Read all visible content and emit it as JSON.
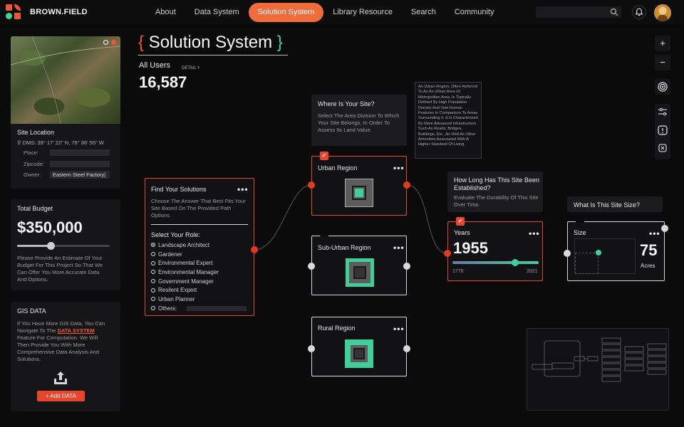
{
  "brand": "BROWN.FIELD",
  "nav": [
    "About",
    "Data System",
    "Solution System",
    "Library Resource",
    "Search",
    "Community"
  ],
  "nav_active": 2,
  "page": {
    "bracket_open": "{",
    "bracket_close": "}",
    "title": "Solution System",
    "all_users_label": "All Users",
    "detail_label": "DETAIL",
    "users_count": "16,587"
  },
  "site": {
    "heading": "Site Location",
    "dms": "DMS: 39° 17' 22\" N, 76° 36' 55\" W",
    "place_label": "Place:",
    "zipcode_label": "Zipcode:",
    "owner_label": "Owner:",
    "owner_value": "Eastern Steel Factory|"
  },
  "budget": {
    "heading": "Total Budget",
    "value": "$350,000",
    "slider_fraction": 0.36,
    "desc": "Please Provide An Estimate Of Your Budget For This Project So That We Can Offer You More Accurate Data And Options."
  },
  "gis": {
    "heading": "GIS DATA",
    "desc_1": "If You Have More GIS Data, You Can Navigate To The",
    "link": "DATA SYSTEM",
    "desc_2": "Feature For Computation. We Will Then Provide You With More Comprehensive Data Analysis And Solutions.",
    "add_button": "+ Add DATA"
  },
  "find": {
    "title": "Find Your Solutions",
    "desc": "Choose The Answer That Best Fits Your Site Based On The Provided Path Options.",
    "role_title": "Select Your Role:",
    "roles": [
      "Landscape Architect",
      "Gardener",
      "Environmental Expert",
      "Environmental Manager",
      "Government Manager",
      "Resilent Expert",
      "Urban Planner",
      "Others:"
    ],
    "selected_role": 0
  },
  "where": {
    "title": "Where Is Your Site?",
    "desc": "Select The Area Division To Which Your Site Belongs, In Order To Assess Its Land Value."
  },
  "urban_tooltip": "An Urban Region, Often Referred To As An Urban Area Or Metropolitan Area, Is Typically Defined By High Population Density And Vast Human Features In Comparison To Areas Surrounding It. It Is Characterized By More Advanced Infrastructure Such As Roads, Bridges, Buildings, Etc., As Well As Other Amenities Associated With A Higher Standard Of Living.",
  "regions": [
    "Urban Region",
    "Sub-Urban Region",
    "Rural Region"
  ],
  "established": {
    "title": "How Long Has This Site Been Established?",
    "desc": "Evaluate The Durability Of This Site Over Time."
  },
  "years": {
    "label": "Years",
    "value": "1955",
    "min": "1776",
    "max": "2021",
    "fraction": 0.73
  },
  "size_q": "What Is This Site Size?",
  "size": {
    "label": "Size",
    "value": "75",
    "unit": "Acres"
  },
  "colors": {
    "accent": "#f26b3a",
    "port_red": "#e23a1c",
    "teal": "#3fcf9a",
    "bracket_red": "#f0562f",
    "bracket_green": "#3fd39b"
  }
}
